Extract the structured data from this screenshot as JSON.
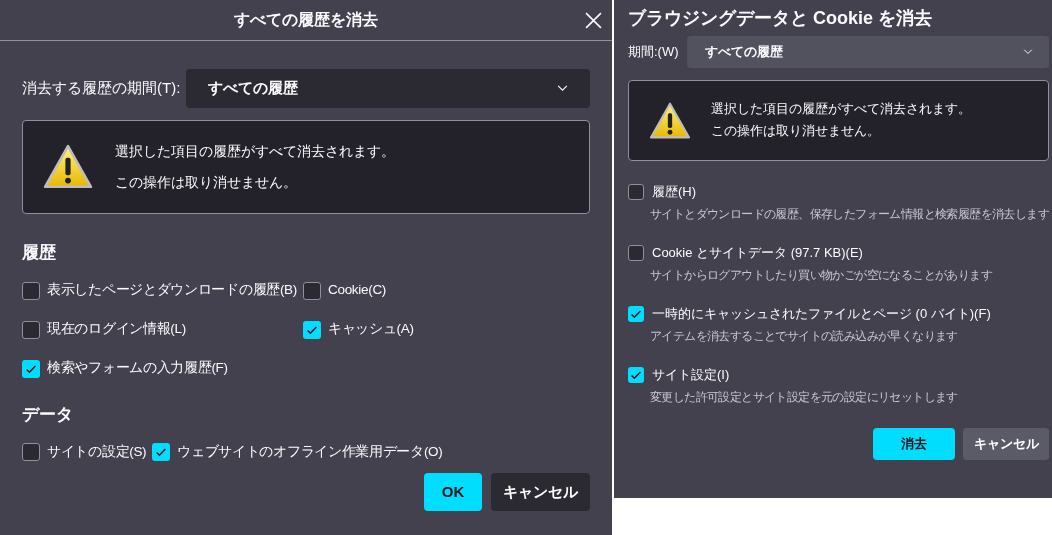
{
  "clear_history_dialog": {
    "title": "すべての履歴を消去",
    "period": {
      "label": "消去する履歴の期間(T):",
      "value": "すべての履歴"
    },
    "warning": [
      "選択した項目の履歴がすべて消去されます。",
      "この操作は取り消せません。"
    ],
    "sections": [
      {
        "heading": "履歴",
        "options": [
          {
            "label": "表示したページとダウンロードの履歴(B)",
            "checked": false
          },
          {
            "label": "Cookie(C)",
            "checked": false
          },
          {
            "label": "現在のログイン情報(L)",
            "checked": false
          },
          {
            "label": "キャッシュ(A)",
            "checked": true
          },
          {
            "label": "検索やフォームの入力履歴(F)",
            "checked": true
          }
        ]
      },
      {
        "heading": "データ",
        "options": [
          {
            "label": "サイトの設定(S)",
            "checked": false
          },
          {
            "label": "ウェブサイトのオフライン作業用データ(O)",
            "checked": true
          }
        ]
      }
    ],
    "buttons": [
      {
        "label": "OK",
        "kind": "primary"
      },
      {
        "label": "キャンセル",
        "kind": "secondary"
      }
    ]
  },
  "clear_data_dialog": {
    "title": "ブラウジングデータと Cookie を消去",
    "period": {
      "label": "期間:(W)",
      "value": "すべての履歴"
    },
    "warning": [
      "選択した項目の履歴がすべて消去されます。",
      "この操作は取り消せません。"
    ],
    "options": [
      {
        "label": "履歴(H)",
        "description": "サイトとダウンロードの履歴、保存したフォーム情報と検索履歴を消去します",
        "checked": false
      },
      {
        "label": "Cookie とサイトデータ (97.7 KB)(E)",
        "description": "サイトからログアウトしたり買い物かごが空になることがあります",
        "checked": false
      },
      {
        "label": "一時的にキャッシュされたファイルとページ (0 バイト)(F)",
        "description": "アイテムを消去することでサイトの読み込みが早くなります",
        "checked": true
      },
      {
        "label": "サイト設定(I)",
        "description": "変更した許可設定とサイト設定を元の設定にリセットします",
        "checked": true
      }
    ],
    "buttons": [
      {
        "label": "消去",
        "kind": "primary"
      },
      {
        "label": "キャンセル",
        "kind": "secondary"
      }
    ]
  }
}
